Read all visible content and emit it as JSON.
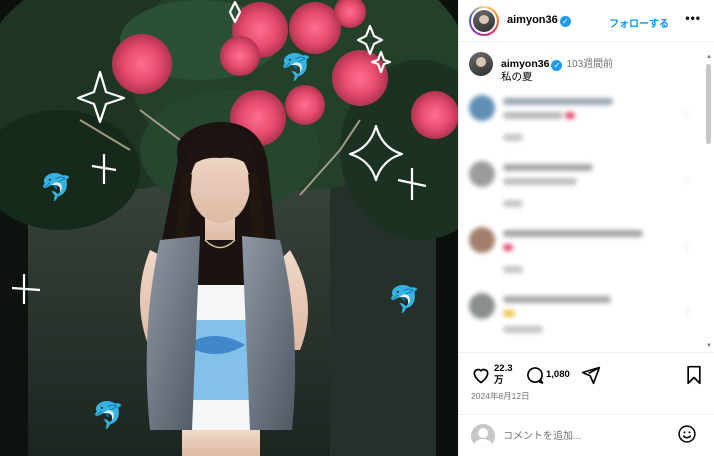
{
  "post": {
    "username": "aimyon36",
    "follow_label": "フォローする",
    "more_label": "•••",
    "caption": {
      "username": "aimyon36",
      "time": "103週間前",
      "text": "私の夏"
    },
    "likes": "22.3万",
    "comments_count": "1,080",
    "date": "2024年8月12日",
    "comment_placeholder": "コメントを追加..."
  },
  "icons": {
    "verified": "✓"
  },
  "colors": {
    "accent": "#0095f6",
    "verified": "#1d9bf0",
    "muted": "#737373"
  }
}
